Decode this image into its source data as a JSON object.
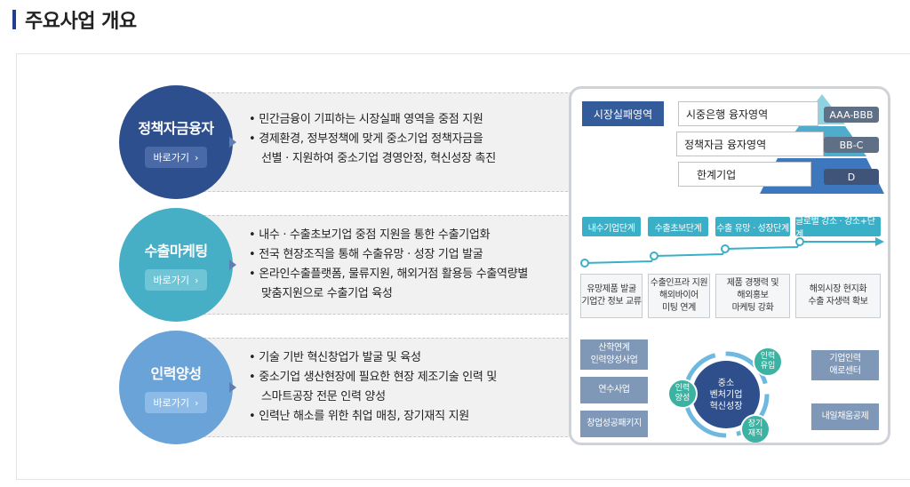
{
  "page": {
    "title": "주요사업 개요"
  },
  "rows": [
    {
      "title": "정책자금융자",
      "button": "바로가기",
      "bullets": [
        "• 민간금융이 기피하는 시장실패 영역을 중점 지원",
        "• 경제환경, 정부정책에 맞게 중소기업 정책자금을",
        "선별 · 지원하여 중소기업 경영안정, 혁신성장 촉진"
      ]
    },
    {
      "title": "수출마케팅",
      "button": "바로가기",
      "bullets": [
        "• 내수 · 수출초보기업 중점 지원을 통한 수출기업화",
        "• 전국 현장조직을 통해 수출유망 · 성장 기업 발굴",
        "• 온라인수출플랫폼, 물류지원, 해외거점 활용등 수출역량별",
        "맞춤지원으로 수출기업 육성"
      ]
    },
    {
      "title": "인력양성",
      "button": "바로가기",
      "bullets": [
        "• 기술 기반 혁신창업가 발굴 및 육성",
        "• 중소기업 생산현장에 필요한 현장 제조기술 인력 및",
        "스마트공장 전문 인력 양성",
        "• 인력난 해소를 위한 취업 매칭, 장기재직 지원"
      ]
    }
  ],
  "panel": {
    "tag": "시장실패영역",
    "pyramid": [
      {
        "label": "시중은행 융자영역",
        "grade": "AAA-BBB"
      },
      {
        "label": "정책자금 융자영역",
        "grade": "BB-C"
      },
      {
        "label": "한계기업",
        "grade": "D"
      }
    ],
    "stages": [
      "내수기업단계",
      "수출초보단계",
      "수출 유망 · 성장단계",
      "글로벌 강소 · 강소+단계"
    ],
    "stage_boxes": [
      [
        "유망제품 발굴",
        "기업간 정보 교류"
      ],
      [
        "수출인프라 지원",
        "해외바이어",
        "미팅 연계"
      ],
      [
        "제품 경쟁력 및",
        "해외홍보",
        "마케팅 강화"
      ],
      [
        "해외시장 현지화",
        "수출 자생력 확보"
      ]
    ],
    "left_boxes": [
      [
        "산학연계",
        "인력양성사업"
      ],
      [
        "연수사업"
      ],
      [
        "창업성공패키지"
      ]
    ],
    "center": [
      "중소",
      "벤처기업",
      "혁신성장"
    ],
    "circles": {
      "left": [
        "인력",
        "양성"
      ],
      "top": [
        "인력",
        "유입"
      ],
      "bottom": [
        "장기",
        "재직"
      ]
    },
    "right_boxes": [
      [
        "기업인력",
        "애로센터"
      ],
      [
        "내일채움공제"
      ]
    ],
    "colors": {
      "navy": "#2d4f8e",
      "teal": "#46aec5",
      "sky": "#6aa3d8",
      "green": "#3cb3a2",
      "gray_blue": "#7f98b8"
    }
  }
}
